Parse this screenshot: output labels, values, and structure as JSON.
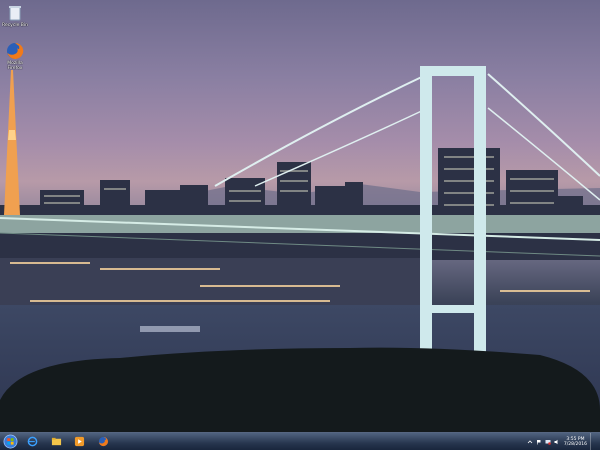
{
  "desktop": {
    "icons": [
      {
        "label": "Recycle Bin",
        "icon": "recycle-bin-icon"
      },
      {
        "label": "Mozilla Firefox",
        "icon": "firefox-icon"
      }
    ]
  },
  "taskbar": {
    "start_icon": "windows-start-icon",
    "pinned": [
      {
        "name": "Internet Explorer",
        "icon": "internet-explorer-icon"
      },
      {
        "name": "Windows Explorer",
        "icon": "folder-icon"
      },
      {
        "name": "Windows Media Player",
        "icon": "media-player-icon"
      },
      {
        "name": "Mozilla Firefox",
        "icon": "firefox-icon"
      }
    ],
    "clock": {
      "time": "3:55 PM",
      "date": "7/28/2016"
    }
  },
  "colors": {
    "taskbar": "#23324b",
    "sky_top": "#6e6a8e",
    "sky_mid": "#b79aa8",
    "bridge_light": "#cfe9ec"
  }
}
